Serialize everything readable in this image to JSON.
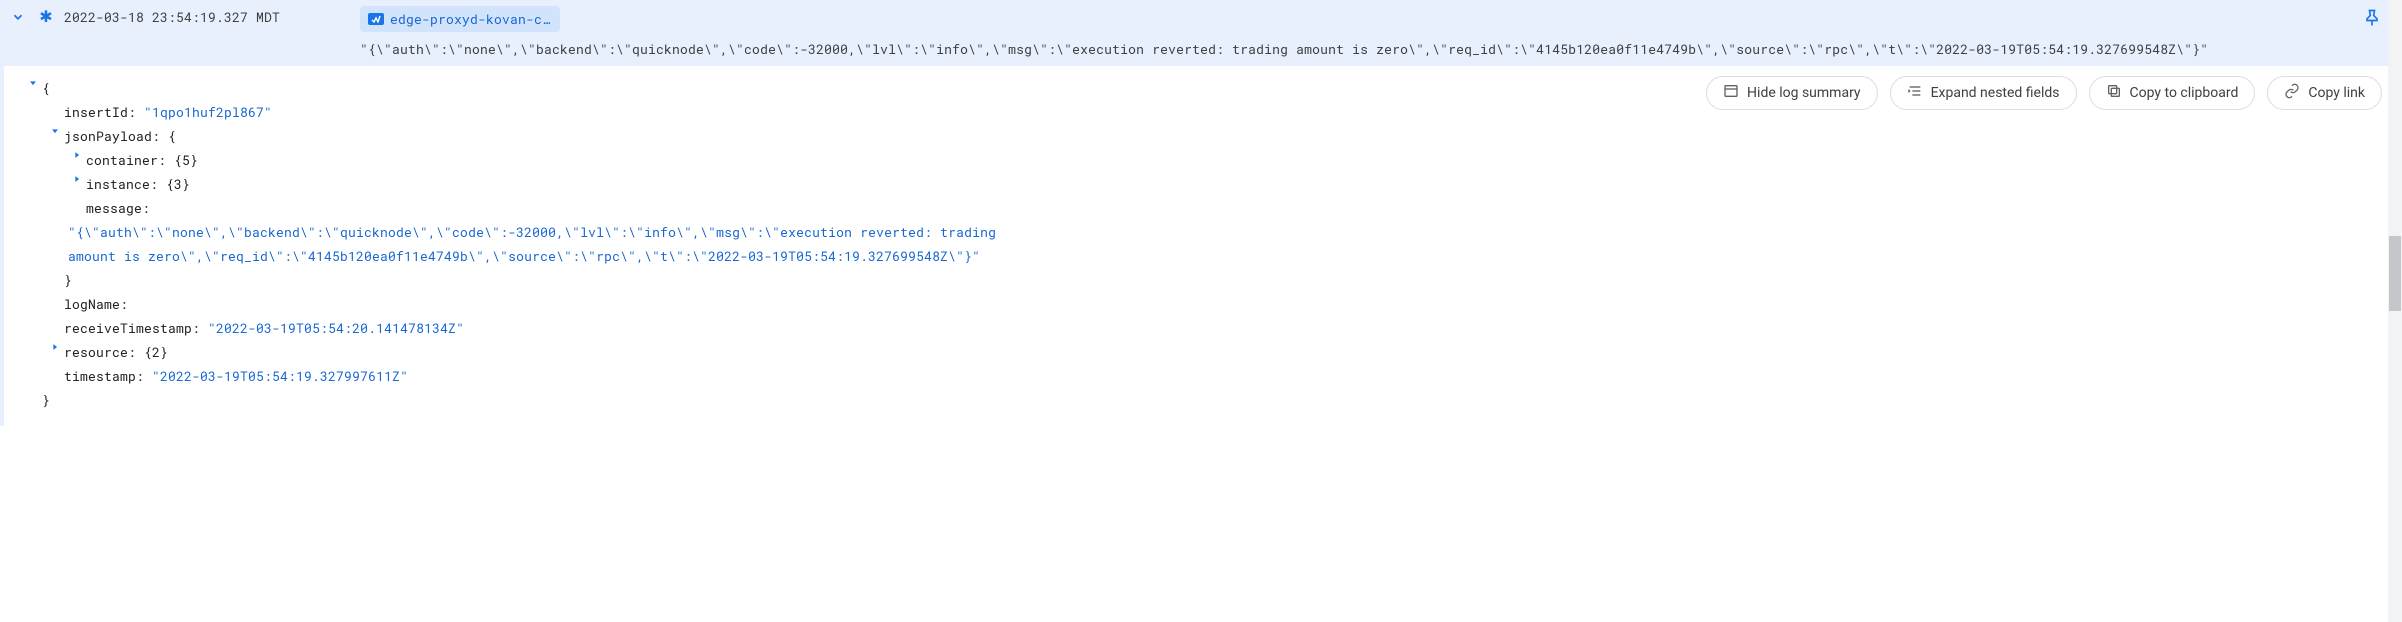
{
  "row": {
    "timestamp": "2022-03-18 23:54:19.327 MDT",
    "chip_label": "edge-proxyd-kovan-c…",
    "summary_msg": "\"{\\\"auth\\\":\\\"none\\\",\\\"backend\\\":\\\"quicknode\\\",\\\"code\\\":-32000,\\\"lvl\\\":\\\"info\\\",\\\"msg\\\":\\\"execution reverted: trading amount is zero\\\",\\\"req_id\\\":\\\"4145b120ea0f11e4749b\\\",\\\"source\\\":\\\"rpc\\\",\\\"t\\\":\\\"2022-03-19T05:54:19.327699548Z\\\"}\""
  },
  "actions": {
    "hide_summary": "Hide log summary",
    "expand_nested": "Expand nested fields",
    "copy_clipboard": "Copy to clipboard",
    "copy_link": "Copy link"
  },
  "detail": {
    "open_brace": "{",
    "insertId_key": "insertId:",
    "insertId_val": "\"1qpo1huf2pl867\"",
    "jsonPayload_key": "jsonPayload:",
    "jsonPayload_open": "{",
    "container_key": "container:",
    "container_val": "{5}",
    "instance_key": "instance:",
    "instance_val": "{3}",
    "message_key": "message:",
    "message_val": "\"{\\\"auth\\\":\\\"none\\\",\\\"backend\\\":\\\"quicknode\\\",\\\"code\\\":-32000,\\\"lvl\\\":\\\"info\\\",\\\"msg\\\":\\\"execution reverted: trading amount is zero\\\",\\\"req_id\\\":\\\"4145b120ea0f11e4749b\\\",\\\"source\\\":\\\"rpc\\\",\\\"t\\\":\\\"2022-03-19T05:54:19.327699548Z\\\"}\"",
    "jsonPayload_close": "}",
    "logName_key": "logName:",
    "receiveTimestamp_key": "receiveTimestamp:",
    "receiveTimestamp_val": "\"2022-03-19T05:54:20.141478134Z\"",
    "resource_key": "resource:",
    "resource_val": "{2}",
    "timestamp_key": "timestamp:",
    "timestamp_val": "\"2022-03-19T05:54:19.327997611Z\"",
    "close_brace": "}"
  },
  "scrollbar": {
    "top_pct": 38,
    "height_pct": 12
  }
}
